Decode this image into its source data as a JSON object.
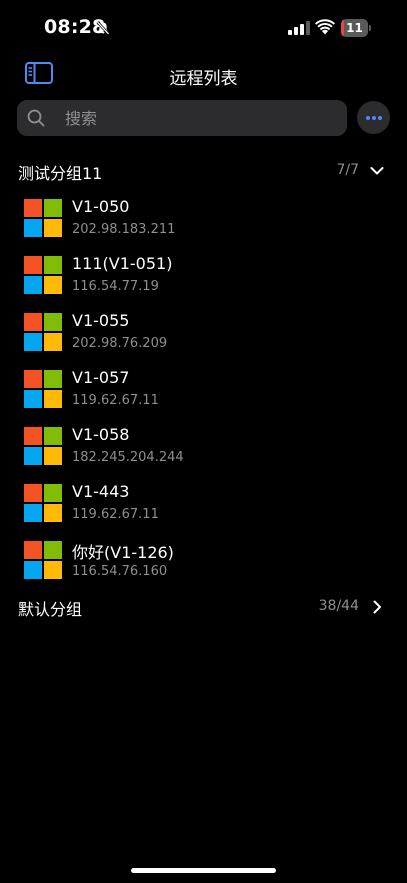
{
  "status_bar": {
    "time": "08:28",
    "battery_level": "11",
    "battery_percent": 11
  },
  "nav": {
    "title": "远程列表"
  },
  "search": {
    "placeholder": "搜索"
  },
  "groups": [
    {
      "name": "测试分组11",
      "count": "7/7",
      "expanded": true,
      "hosts": [
        {
          "name": "V1-050",
          "ip": "202.98.183.211",
          "os_icon": "windows-icon"
        },
        {
          "name": "111(V1-051)",
          "ip": "116.54.77.19",
          "os_icon": "windows-icon"
        },
        {
          "name": "V1-055",
          "ip": "202.98.76.209",
          "os_icon": "windows-icon"
        },
        {
          "name": "V1-057",
          "ip": "119.62.67.11",
          "os_icon": "windows-icon"
        },
        {
          "name": "V1-058",
          "ip": "182.245.204.244",
          "os_icon": "windows-icon"
        },
        {
          "name": "V1-443",
          "ip": "119.62.67.11",
          "os_icon": "windows-icon"
        },
        {
          "name": "你好(V1-126)",
          "ip": "116.54.76.160",
          "os_icon": "windows-icon"
        }
      ]
    },
    {
      "name": "默认分组",
      "count": "38/44",
      "expanded": false,
      "hosts": []
    }
  ],
  "colors": {
    "background": "#000000",
    "search_background": "#2c2c2e",
    "accent": "#4d8cf5",
    "secondary_text": "#8e8e93",
    "windows_red": "#f35325",
    "windows_green": "#81bc06",
    "windows_blue": "#05a6f0",
    "windows_yellow": "#ffba08"
  }
}
